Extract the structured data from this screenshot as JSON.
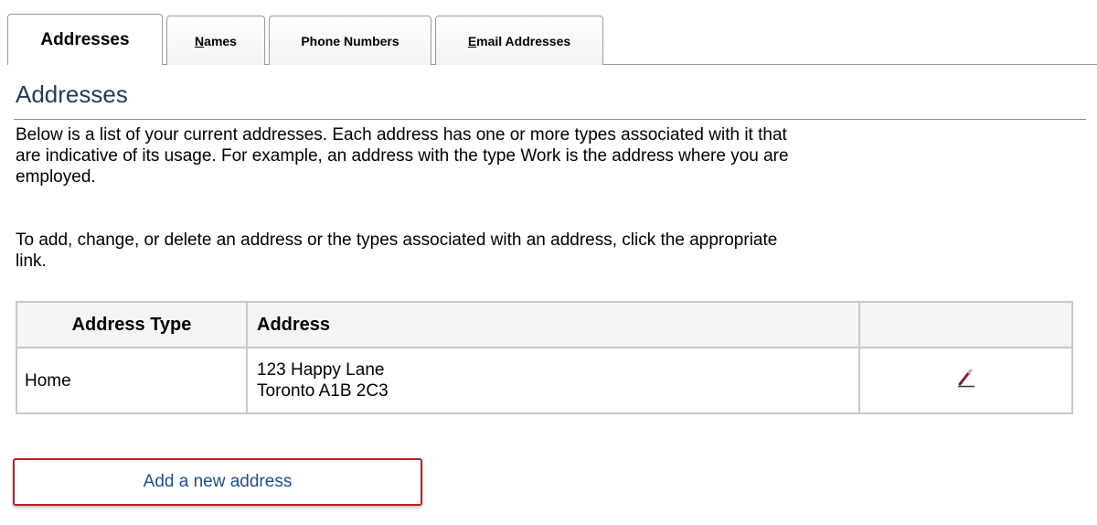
{
  "tabs": [
    {
      "label": "Addresses",
      "active": true
    },
    {
      "label": "Names",
      "active": false
    },
    {
      "label": "Phone Numbers",
      "active": false
    },
    {
      "label": "Email Addresses",
      "active": false
    }
  ],
  "page": {
    "title": "Addresses",
    "intro": "Below is a list of your current addresses. Each address has one or more types associated with it that are indicative of its usage. For example, an address with the type Work is the address where you are employed.",
    "instructions": "To add, change, or delete an address or the types associated with an address, click the appropriate link."
  },
  "table": {
    "headers": [
      "Address Type",
      "Address",
      ""
    ],
    "rows": [
      {
        "type": "Home",
        "address_line1": "123 Happy Lane",
        "address_line2": "Toronto A1B 2C3",
        "action_icon": "edit-pencil-icon"
      }
    ]
  },
  "buttons": {
    "add_address": "Add a new address"
  },
  "colors": {
    "title": "#1f3b5c",
    "button_border": "#b22222",
    "button_text": "#1f4e8c",
    "table_border": "#c8c8c8"
  }
}
